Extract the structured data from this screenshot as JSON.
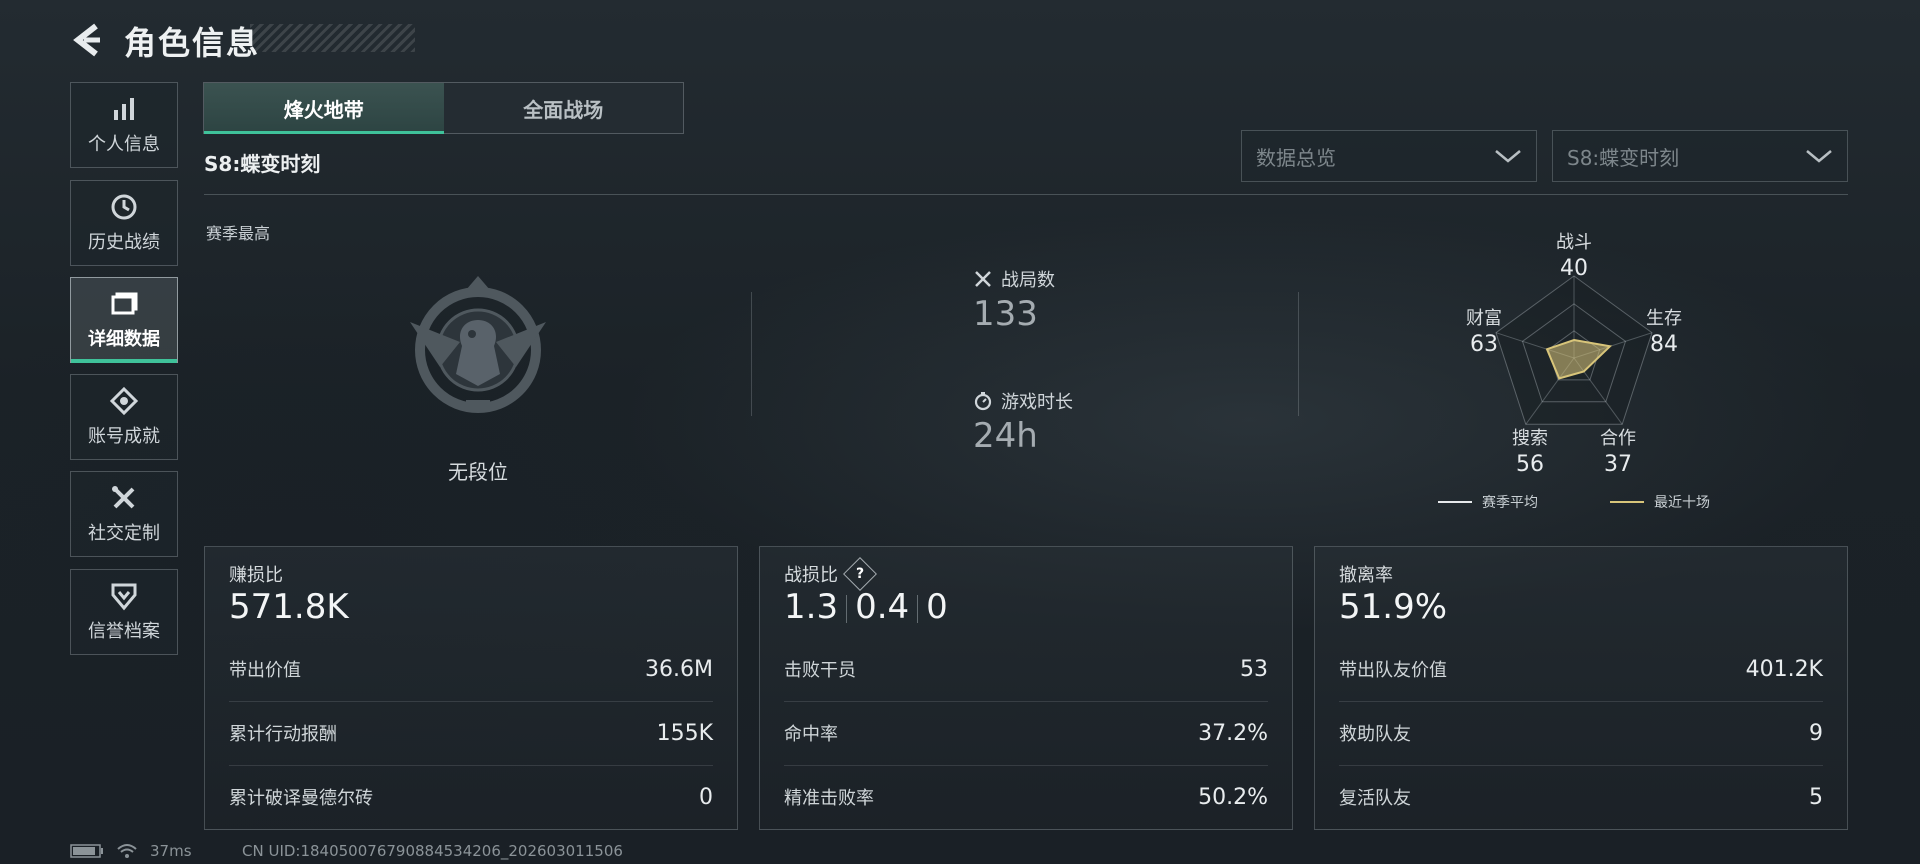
{
  "header": {
    "title": "角色信息"
  },
  "sidebar": {
    "items": [
      {
        "label": "个人信息",
        "icon": "bar-chart-icon"
      },
      {
        "label": "历史战绩",
        "icon": "history-clock-icon"
      },
      {
        "label": "详细数据",
        "icon": "folder-icon",
        "active": true
      },
      {
        "label": "账号成就",
        "icon": "achievement-icon"
      },
      {
        "label": "社交定制",
        "icon": "tools-icon"
      },
      {
        "label": "信誉档案",
        "icon": "credit-shield-icon"
      }
    ]
  },
  "tabs": [
    {
      "label": "烽火地带",
      "active": true
    },
    {
      "label": "全面战场",
      "active": false
    }
  ],
  "season_name": "S8:蝶变时刻",
  "dropdowns": {
    "view": "数据总览",
    "season": "S8:蝶变时刻"
  },
  "overview": {
    "season_best_label": "赛季最高",
    "rank_text": "无段位",
    "matches_label": "战局数",
    "matches_value": "133",
    "playtime_label": "游戏时长",
    "playtime_value": "24h"
  },
  "radar": {
    "axes": [
      {
        "label": "战斗",
        "value": "40"
      },
      {
        "label": "生存",
        "value": "84"
      },
      {
        "label": "合作",
        "value": "37"
      },
      {
        "label": "搜索",
        "value": "56"
      },
      {
        "label": "财富",
        "value": "63"
      }
    ],
    "legend": [
      {
        "label": "赛季平均",
        "color": "#e6e9eb"
      },
      {
        "label": "最近十场",
        "color": "#d8c57a"
      }
    ]
  },
  "cards": [
    {
      "title": "赚损比",
      "value": "571.8K",
      "rows": [
        {
          "k": "带出价值",
          "v": "36.6M"
        },
        {
          "k": "累计行动报酬",
          "v": "155K"
        },
        {
          "k": "累计破译曼德尔砖",
          "v": "0"
        }
      ]
    },
    {
      "title": "战损比",
      "help": "?",
      "values": [
        "1.3",
        "0.4",
        "0"
      ],
      "rows": [
        {
          "k": "击败干员",
          "v": "53"
        },
        {
          "k": "命中率",
          "v": "37.2%"
        },
        {
          "k": "精准击败率",
          "v": "50.2%"
        }
      ]
    },
    {
      "title": "撤离率",
      "value": "51.9%",
      "rows": [
        {
          "k": "带出队友价值",
          "v": "401.2K"
        },
        {
          "k": "救助队友",
          "v": "9"
        },
        {
          "k": "复活队友",
          "v": "5"
        }
      ]
    }
  ],
  "status_bar": {
    "ping": "37ms",
    "uid": "CN UID:184050076790884534206_202603011506"
  }
}
